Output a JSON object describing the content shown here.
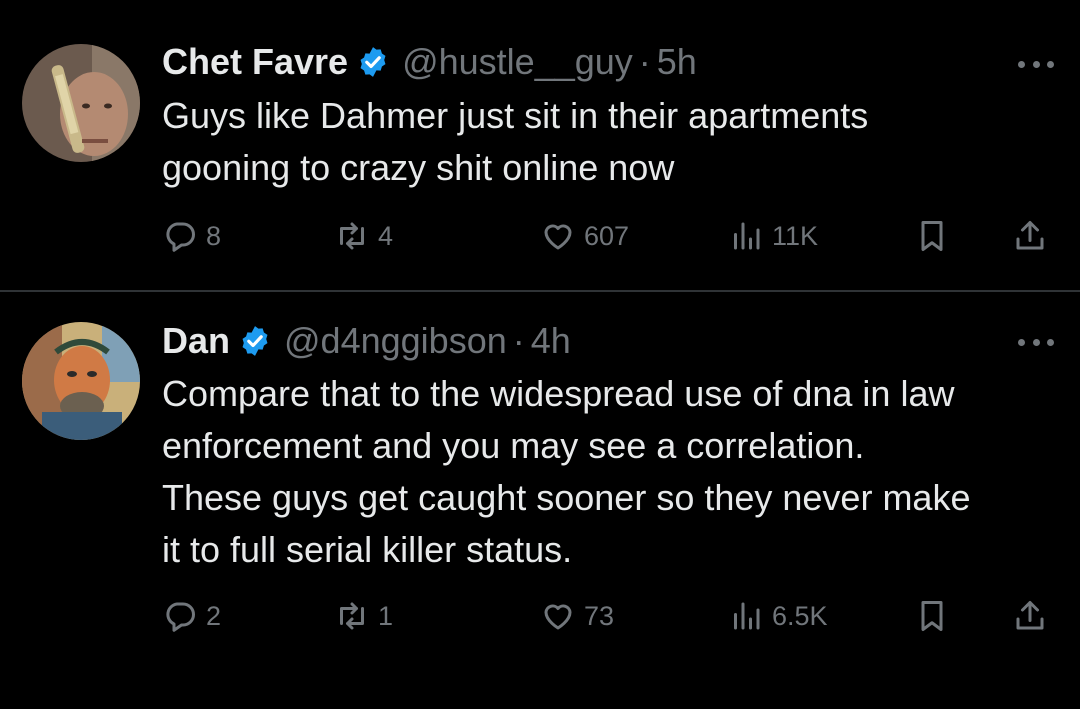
{
  "tweets": [
    {
      "author": {
        "name": "Chet Favre",
        "handle": "@hustle__guy",
        "verified": true
      },
      "separator": "·",
      "time": "5h",
      "text": "Guys like Dahmer just sit in their apartments\ngooning to crazy shit online now",
      "stats": {
        "replies": "8",
        "reposts": "4",
        "likes": "607",
        "views": "11K"
      }
    },
    {
      "author": {
        "name": "Dan",
        "handle": "@d4nggibson",
        "verified": true
      },
      "separator": "·",
      "time": "4h",
      "text": "Compare that to the widespread use of dna in law\nenforcement and you may see a correlation.\nThese guys get caught sooner so they never make\nit to full serial killer status.",
      "stats": {
        "replies": "2",
        "reposts": "1",
        "likes": "73",
        "views": "6.5K"
      }
    }
  ],
  "icons": {
    "reply": "reply-icon",
    "repost": "repost-icon",
    "like": "heart-icon",
    "views": "views-icon",
    "bookmark": "bookmark-icon",
    "share": "share-icon",
    "more": "more-icon",
    "verified": "verified-badge-icon"
  },
  "colors": {
    "background": "#000000",
    "text": "#e7e9ea",
    "secondary": "#71767b",
    "verified": "#1d9bf0",
    "divider": "#2f3336"
  }
}
